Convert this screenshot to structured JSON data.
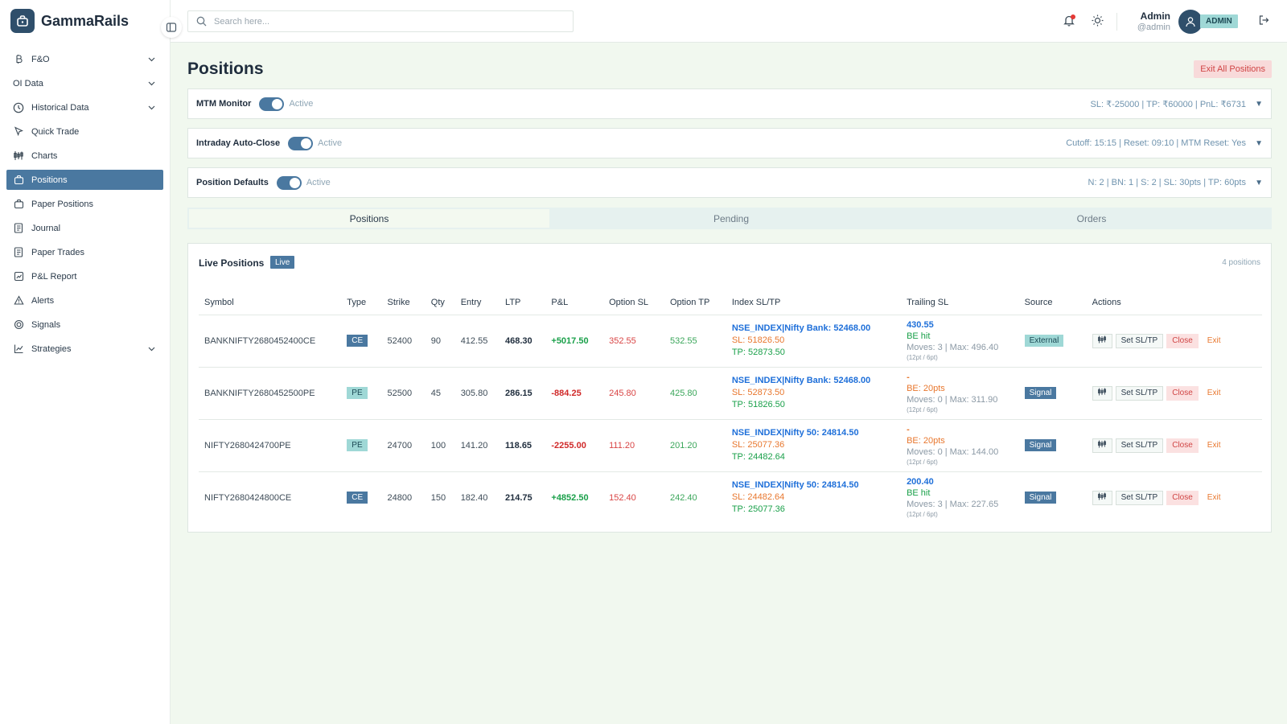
{
  "brand": {
    "name": "GammaRails"
  },
  "sidebar": {
    "items": [
      {
        "label": "F&O",
        "icon": "bitcoin-icon",
        "has_chevron": true,
        "active": false
      },
      {
        "label": "OI Data",
        "icon": "",
        "has_chevron": true,
        "active": false
      },
      {
        "label": "Historical Data",
        "icon": "clock-icon",
        "has_chevron": true,
        "active": false
      },
      {
        "label": "Quick Trade",
        "icon": "cursor-icon",
        "has_chevron": false,
        "active": false
      },
      {
        "label": "Charts",
        "icon": "candles-icon",
        "has_chevron": false,
        "active": false
      },
      {
        "label": "Positions",
        "icon": "briefcase-icon",
        "has_chevron": false,
        "active": true
      },
      {
        "label": "Paper Positions",
        "icon": "briefcase-icon",
        "has_chevron": false,
        "active": false
      },
      {
        "label": "Journal",
        "icon": "notebook-icon",
        "has_chevron": false,
        "active": false
      },
      {
        "label": "Paper Trades",
        "icon": "notebook-icon",
        "has_chevron": false,
        "active": false
      },
      {
        "label": "P&L Report",
        "icon": "report-icon",
        "has_chevron": false,
        "active": false
      },
      {
        "label": "Alerts",
        "icon": "alert-icon",
        "has_chevron": false,
        "active": false
      },
      {
        "label": "Signals",
        "icon": "signal-icon",
        "has_chevron": false,
        "active": false
      },
      {
        "label": "Strategies",
        "icon": "strategy-icon",
        "has_chevron": true,
        "active": false
      }
    ]
  },
  "topbar": {
    "search_placeholder": "Search here...",
    "user_name": "Admin",
    "user_handle": "@admin",
    "role": "ADMIN"
  },
  "page": {
    "title": "Positions",
    "exit_all_label": "Exit All Positions"
  },
  "config_panels": [
    {
      "title": "MTM Monitor",
      "state": "Active",
      "summary": "SL: ₹-25000 | TP: ₹60000 | PnL: ₹6731"
    },
    {
      "title": "Intraday Auto-Close",
      "state": "Active",
      "summary": "Cutoff: 15:15 | Reset: 09:10 | MTM Reset: Yes"
    },
    {
      "title": "Position Defaults",
      "state": "Active",
      "summary": "N: 2 | BN: 1 | S: 2 | SL: 30pts | TP: 60pts"
    }
  ],
  "tabs": [
    {
      "label": "Positions",
      "active": true
    },
    {
      "label": "Pending",
      "active": false
    },
    {
      "label": "Orders",
      "active": false
    }
  ],
  "live_positions": {
    "title": "Live Positions",
    "badge": "Live",
    "count_text": "4 positions",
    "columns": [
      "Symbol",
      "Type",
      "Strike",
      "Qty",
      "Entry",
      "LTP",
      "P&L",
      "Option SL",
      "Option TP",
      "Index SL/TP",
      "Trailing SL",
      "Source",
      "Actions"
    ],
    "action_labels": {
      "set_sltp": "Set SL/TP",
      "close": "Close",
      "exit": "Exit"
    },
    "rows": [
      {
        "symbol": "BANKNIFTY2680452400CE",
        "type": "CE",
        "strike": "52400",
        "qty": "90",
        "entry": "412.55",
        "ltp": "468.30",
        "pnl": "+5017.50",
        "pnl_sign": "pos",
        "option_sl": "352.55",
        "option_tp": "532.55",
        "index_line": "NSE_INDEX|Nifty Bank: 52468.00",
        "index_sl": "SL: 51826.50",
        "index_tp": "TP: 52873.50",
        "trail_value": "430.55",
        "trail_value_color": "blue",
        "trail_be": "BE hit",
        "trail_be_color": "green",
        "trail_moves": "Moves: 3 | Max: 496.40",
        "trail_step": "(12pt / 6pt)",
        "source": "External",
        "source_kind": "ext"
      },
      {
        "symbol": "BANKNIFTY2680452500PE",
        "type": "PE",
        "strike": "52500",
        "qty": "45",
        "entry": "305.80",
        "ltp": "286.15",
        "pnl": "-884.25",
        "pnl_sign": "neg",
        "option_sl": "245.80",
        "option_tp": "425.80",
        "index_line": "NSE_INDEX|Nifty Bank: 52468.00",
        "index_sl": "SL: 52873.50",
        "index_tp": "TP: 51826.50",
        "trail_value": "-",
        "trail_value_color": "orange",
        "trail_be": "BE: 20pts",
        "trail_be_color": "orange",
        "trail_moves": "Moves: 0 | Max: 311.90",
        "trail_step": "(12pt / 6pt)",
        "source": "Signal",
        "source_kind": "sig"
      },
      {
        "symbol": "NIFTY2680424700PE",
        "type": "PE",
        "strike": "24700",
        "qty": "100",
        "entry": "141.20",
        "ltp": "118.65",
        "pnl": "-2255.00",
        "pnl_sign": "neg",
        "option_sl": "111.20",
        "option_tp": "201.20",
        "index_line": "NSE_INDEX|Nifty 50: 24814.50",
        "index_sl": "SL: 25077.36",
        "index_tp": "TP: 24482.64",
        "trail_value": "-",
        "trail_value_color": "orange",
        "trail_be": "BE: 20pts",
        "trail_be_color": "orange",
        "trail_moves": "Moves: 0 | Max: 144.00",
        "trail_step": "(12pt / 6pt)",
        "source": "Signal",
        "source_kind": "sig"
      },
      {
        "symbol": "NIFTY2680424800CE",
        "type": "CE",
        "strike": "24800",
        "qty": "150",
        "entry": "182.40",
        "ltp": "214.75",
        "pnl": "+4852.50",
        "pnl_sign": "pos",
        "option_sl": "152.40",
        "option_tp": "242.40",
        "index_line": "NSE_INDEX|Nifty 50: 24814.50",
        "index_sl": "SL: 24482.64",
        "index_tp": "TP: 25077.36",
        "trail_value": "200.40",
        "trail_value_color": "blue",
        "trail_be": "BE hit",
        "trail_be_color": "green",
        "trail_moves": "Moves: 3 | Max: 227.65",
        "trail_step": "(12pt / 6pt)",
        "source": "Signal",
        "source_kind": "sig"
      }
    ]
  }
}
